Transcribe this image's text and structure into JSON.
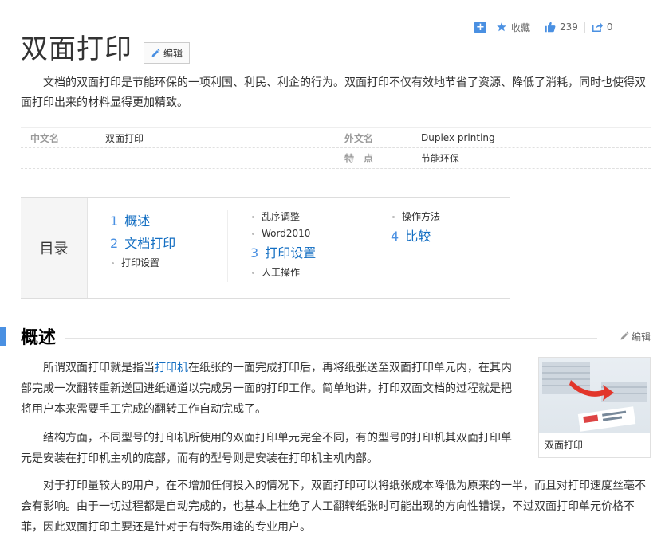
{
  "toolbar": {
    "add_icon": "plus-icon",
    "favorite_label": "收藏",
    "like_count": "239",
    "share_count": "0"
  },
  "entry": {
    "title": "双面打印",
    "edit_label": "编辑",
    "summary": "文档的双面打印是节能环保的一项利国、利民、利企的行为。双面打印不仅有效地节省了资源、降低了消耗，同时也使得双面打印出来的材料显得更加精致。"
  },
  "basic_info": [
    {
      "n1": "中文名",
      "v1": "双面打印",
      "n2": "外文名",
      "v2": "Duplex printing"
    },
    {
      "n1": "",
      "v1": "",
      "n2": "特　点",
      "v2": "节能环保"
    }
  ],
  "catalog": {
    "title": "目录",
    "columns": [
      {
        "items": [
          {
            "level": 1,
            "num": "1",
            "text": "概述"
          },
          {
            "level": 1,
            "num": "2",
            "text": "文档打印"
          },
          {
            "level": 2,
            "text": "打印设置"
          }
        ]
      },
      {
        "items": [
          {
            "level": 2,
            "text": "乱序调整"
          },
          {
            "level": 2,
            "text": "Word2010"
          },
          {
            "level": 1,
            "num": "3",
            "text": "打印设置"
          },
          {
            "level": 2,
            "text": "人工操作"
          }
        ]
      },
      {
        "items": [
          {
            "level": 2,
            "text": "操作方法"
          },
          {
            "level": 1,
            "num": "4",
            "text": "比较"
          }
        ]
      }
    ]
  },
  "section": {
    "title": "概述",
    "edit_label": "编辑",
    "p1_before": "所谓双面打印就是指当",
    "p1_link": "打印机",
    "p1_after": "在纸张的一面完成打印后，再将纸张送至双面打印单元内，在其内部完成一次翻转重新送回进纸通道以完成另一面的打印工作。简单地讲，打印双面文档的过程就是把将用户本来需要手工完成的翻转工作自动完成了。",
    "p2": "结构方面，不同型号的打印机所使用的双面打印单元完全不同，有的型号的打印机其双面打印单元是安装在打印机主机的底部，而有的型号则是安装在打印机主机内部。",
    "p3": "对于打印量较大的用户，在不增加任何投入的情况下，双面打印可以将纸张成本降低为原来的一半，而且对打印速度丝毫不会有影响。由于一切过程都是自动完成的，也基本上杜绝了人工翻转纸张时可能出现的方向性错误，不过双面打印单元价格不菲，因此双面打印主要还是针对于有特殊用途的专业用户。",
    "figure_caption": "双面打印"
  }
}
